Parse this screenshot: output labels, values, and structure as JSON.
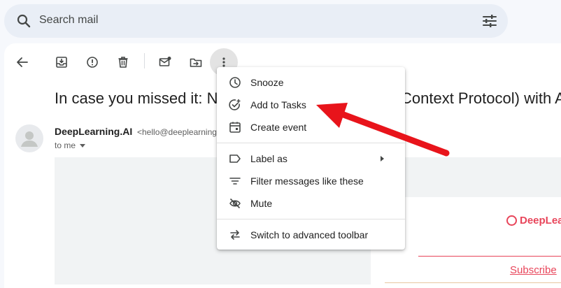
{
  "search": {
    "placeholder": "Search mail",
    "icon": "search-icon",
    "options_icon": "tune-icon"
  },
  "toolbar": {
    "back_icon": "arrow-back-icon",
    "archive_icon": "archive-icon",
    "spam_icon": "report-spam-icon",
    "delete_icon": "delete-icon",
    "mark_unread_icon": "mark-unread-icon",
    "move_to_icon": "move-to-folder-icon",
    "more_icon": "more-vertical-icon"
  },
  "message": {
    "subject_left": "In case you missed it: No",
    "subject_right": "Context Protocol) with A",
    "sender_name": "DeepLearning.AI",
    "sender_email": "<hello@deeplearning",
    "to": "to me"
  },
  "email_content": {
    "brand": "DeepLea",
    "subscribe": "Subscribe"
  },
  "menu": {
    "items": [
      {
        "label": "Snooze",
        "icon": "clock-icon"
      },
      {
        "label": "Add to Tasks",
        "icon": "add-task-icon"
      },
      {
        "label": "Create event",
        "icon": "calendar-event-icon"
      },
      {
        "label": "Label as",
        "icon": "label-icon"
      },
      {
        "label": "Filter messages like these",
        "icon": "filter-icon"
      },
      {
        "label": "Mute",
        "icon": "mute-icon"
      },
      {
        "label": "Switch to advanced toolbar",
        "icon": "swap-arrows-icon"
      }
    ]
  },
  "colors": {
    "annotation_arrow": "#e8141b",
    "brand": "#e8455a"
  }
}
